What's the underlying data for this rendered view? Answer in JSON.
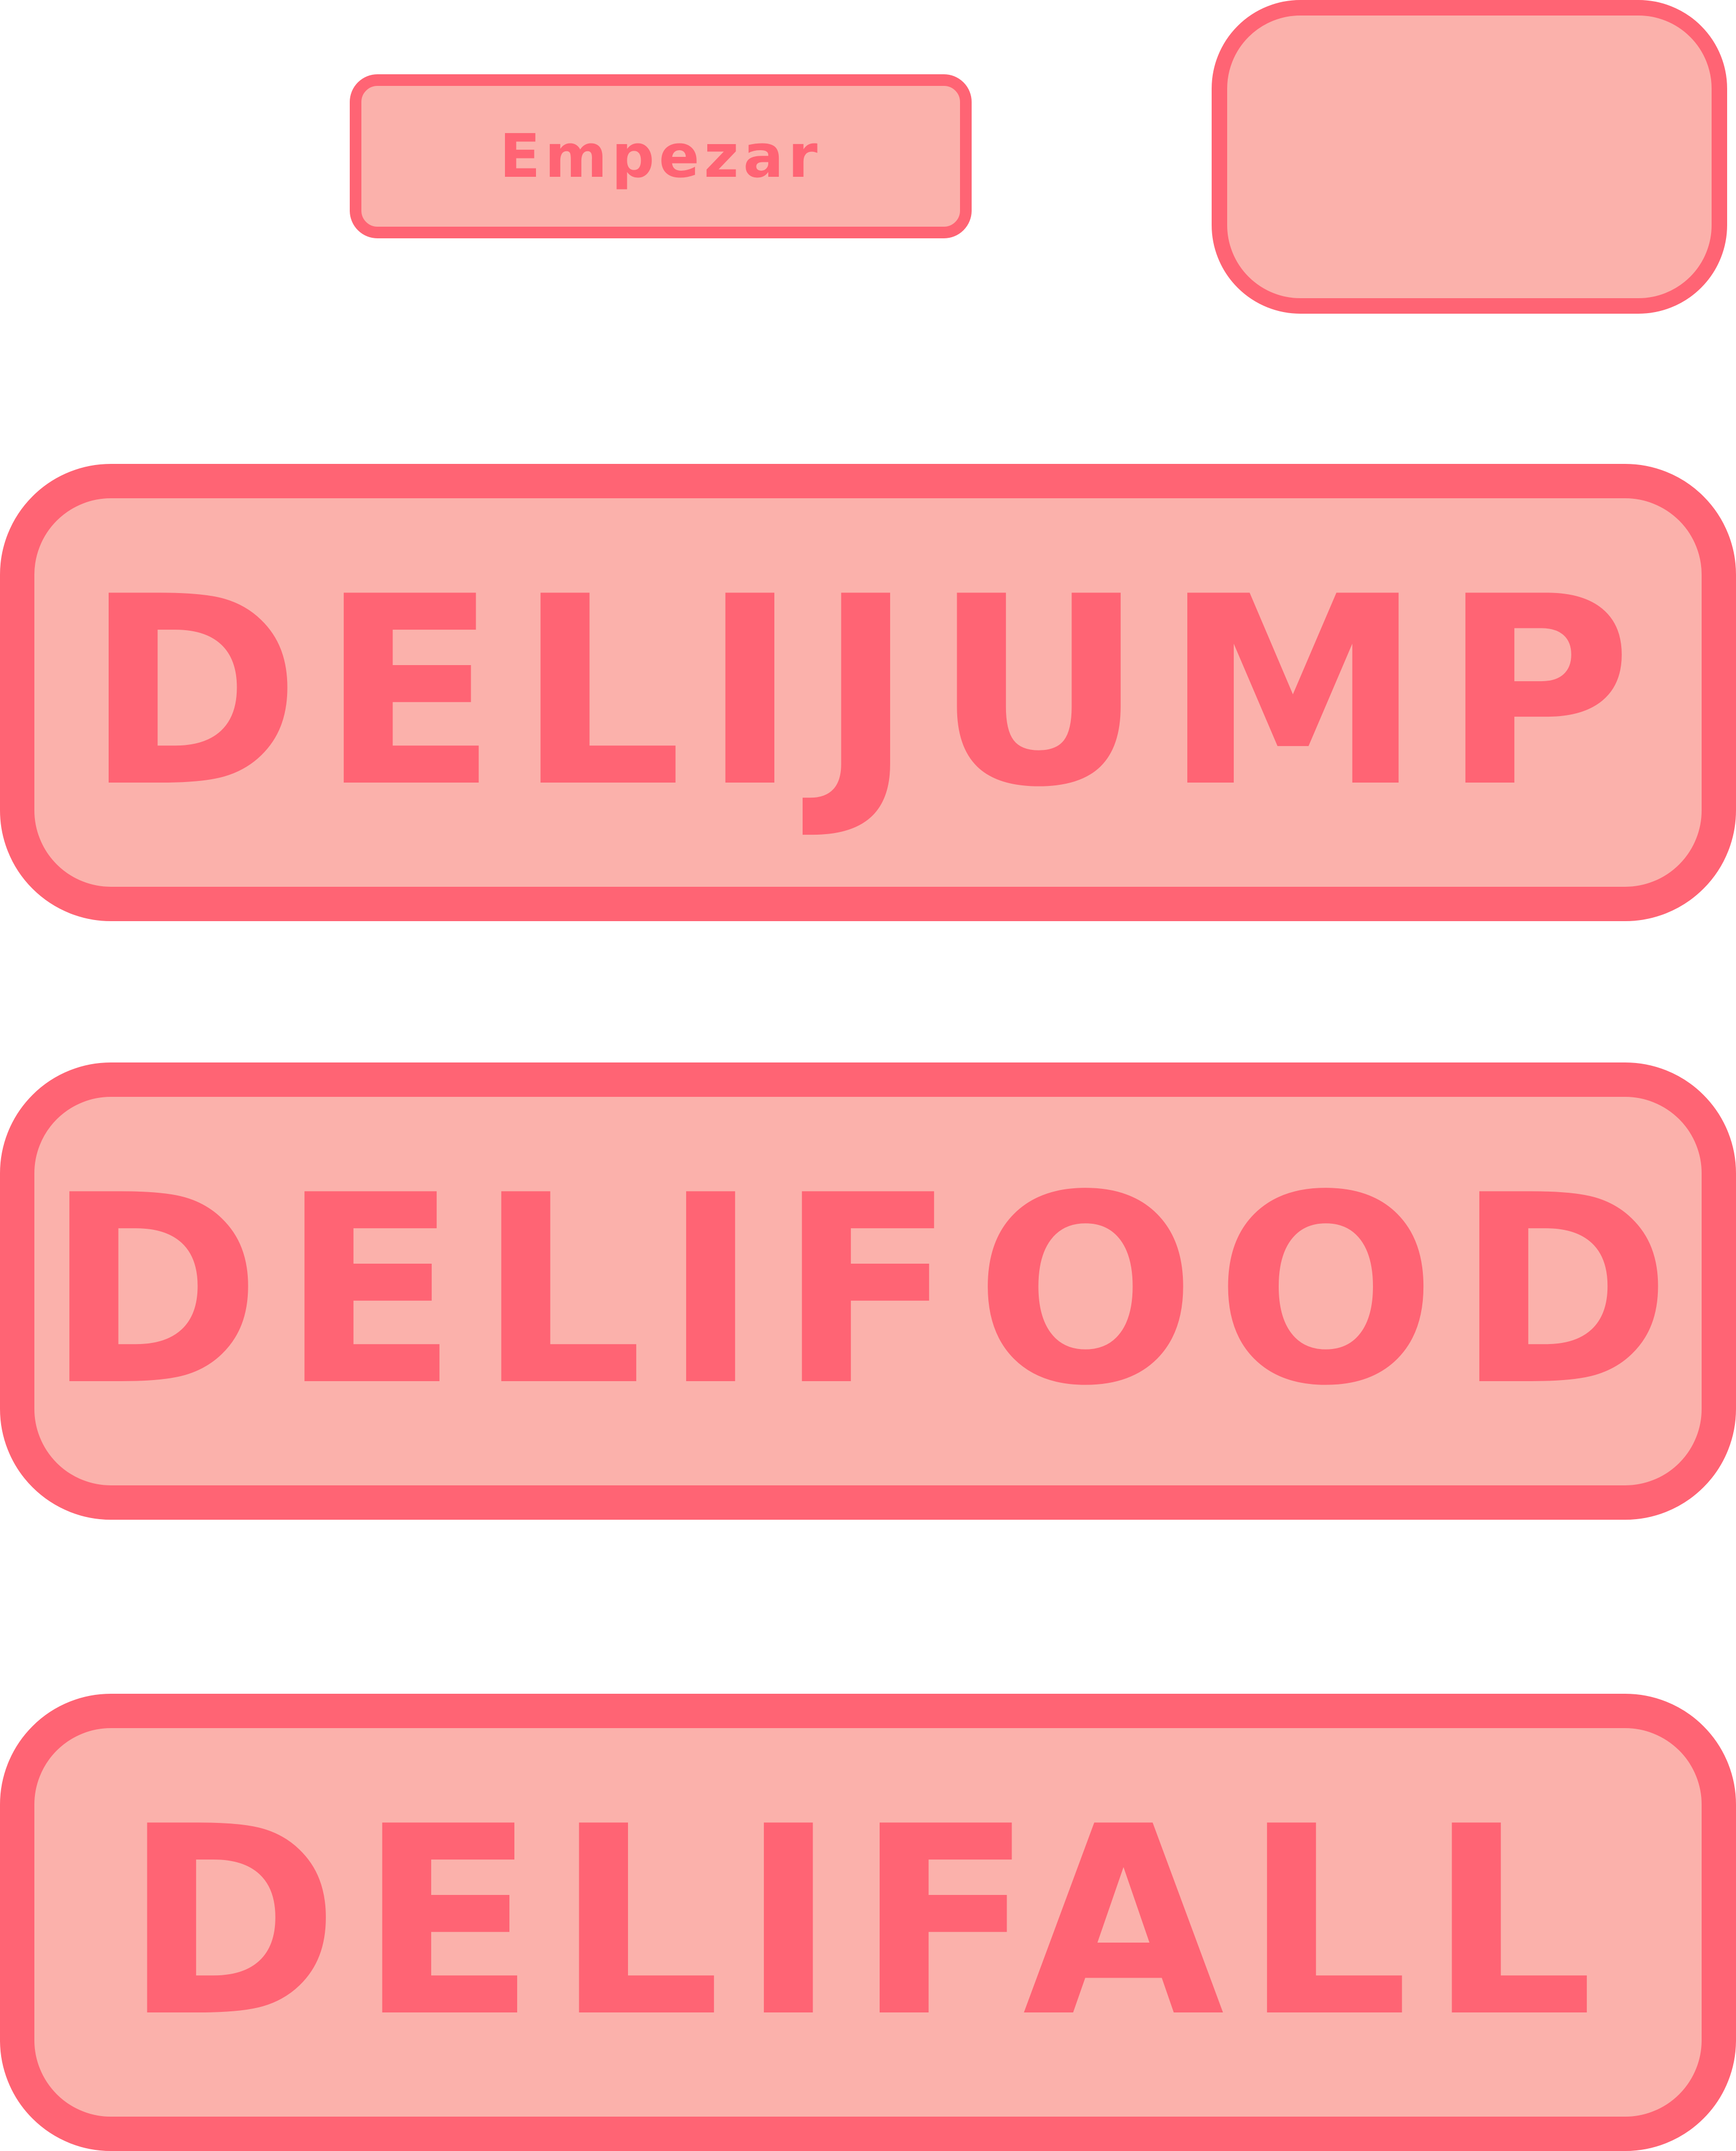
{
  "buttons": {
    "start_label": "Empezar",
    "top_right_label": "",
    "games": [
      {
        "label": "DELIJUMP"
      },
      {
        "label": "DELIFOOD"
      },
      {
        "label": "DELIFALL"
      }
    ]
  },
  "colors": {
    "fill": "#fbb1ab",
    "border": "#ff6474",
    "text": "#ff6474",
    "background": "#ffffff"
  }
}
